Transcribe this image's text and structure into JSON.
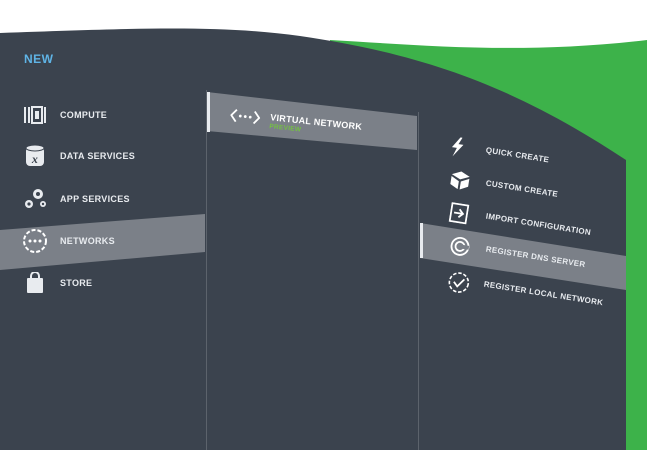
{
  "header": {
    "new_label": "NEW"
  },
  "nav": {
    "items": [
      {
        "label": "COMPUTE",
        "icon": "compute-icon"
      },
      {
        "label": "DATA SERVICES",
        "icon": "data-services-icon"
      },
      {
        "label": "APP SERVICES",
        "icon": "app-services-icon"
      },
      {
        "label": "NETWORKS",
        "icon": "networks-icon",
        "selected": true
      },
      {
        "label": "STORE",
        "icon": "store-icon"
      }
    ]
  },
  "middle": {
    "item": {
      "label": "VIRTUAL NETWORK",
      "sublabel": "PREVIEW",
      "icon": "virtual-network-icon",
      "selected": true
    }
  },
  "actions": {
    "items": [
      {
        "label": "QUICK CREATE",
        "icon": "lightning-icon"
      },
      {
        "label": "CUSTOM CREATE",
        "icon": "cube-icon"
      },
      {
        "label": "IMPORT CONFIGURATION",
        "icon": "import-icon"
      },
      {
        "label": "REGISTER DNS SERVER",
        "icon": "dns-server-icon",
        "selected": true
      },
      {
        "label": "REGISTER LOCAL NETWORK",
        "icon": "check-circle-icon"
      }
    ]
  },
  "colors": {
    "panel": "#3b434e",
    "highlight": "#7b8088",
    "accent_green": "#3db24a",
    "new_blue": "#5fb4e6",
    "preview_green": "#74c044"
  }
}
